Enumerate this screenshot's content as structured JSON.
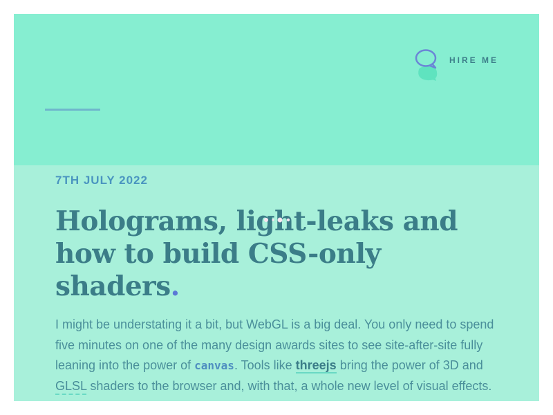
{
  "header": {
    "hire_me_label": "HIRE ME",
    "hire_me_icon": "speech-bubble-icon"
  },
  "post": {
    "date": "7TH JULY 2022",
    "title": "Holograms, light-leaks and how to build CSS-only shaders",
    "title_end": ".",
    "body": {
      "part1": "I might be understating it a bit, but WebGL is a big deal. You only need to spend five minutes on one of the many design awards sites to see site-after-site fully leaning into the power of ",
      "canvas_label": "canvas",
      "part2": ". Tools like ",
      "threejs_label": "threejs",
      "part3": " bring the power of 3D and ",
      "glsl_label": "GLSL",
      "part4": " shaders to the browser and, with that, a whole new level of visual effects."
    }
  },
  "colors": {
    "hero_bg": "#86eed1",
    "content_bg": "#a8f0da",
    "heading": "#3b7d88",
    "date": "#4a95c0",
    "accent_dot": "#5b78d6",
    "link_underline": "#6ad9c4"
  }
}
